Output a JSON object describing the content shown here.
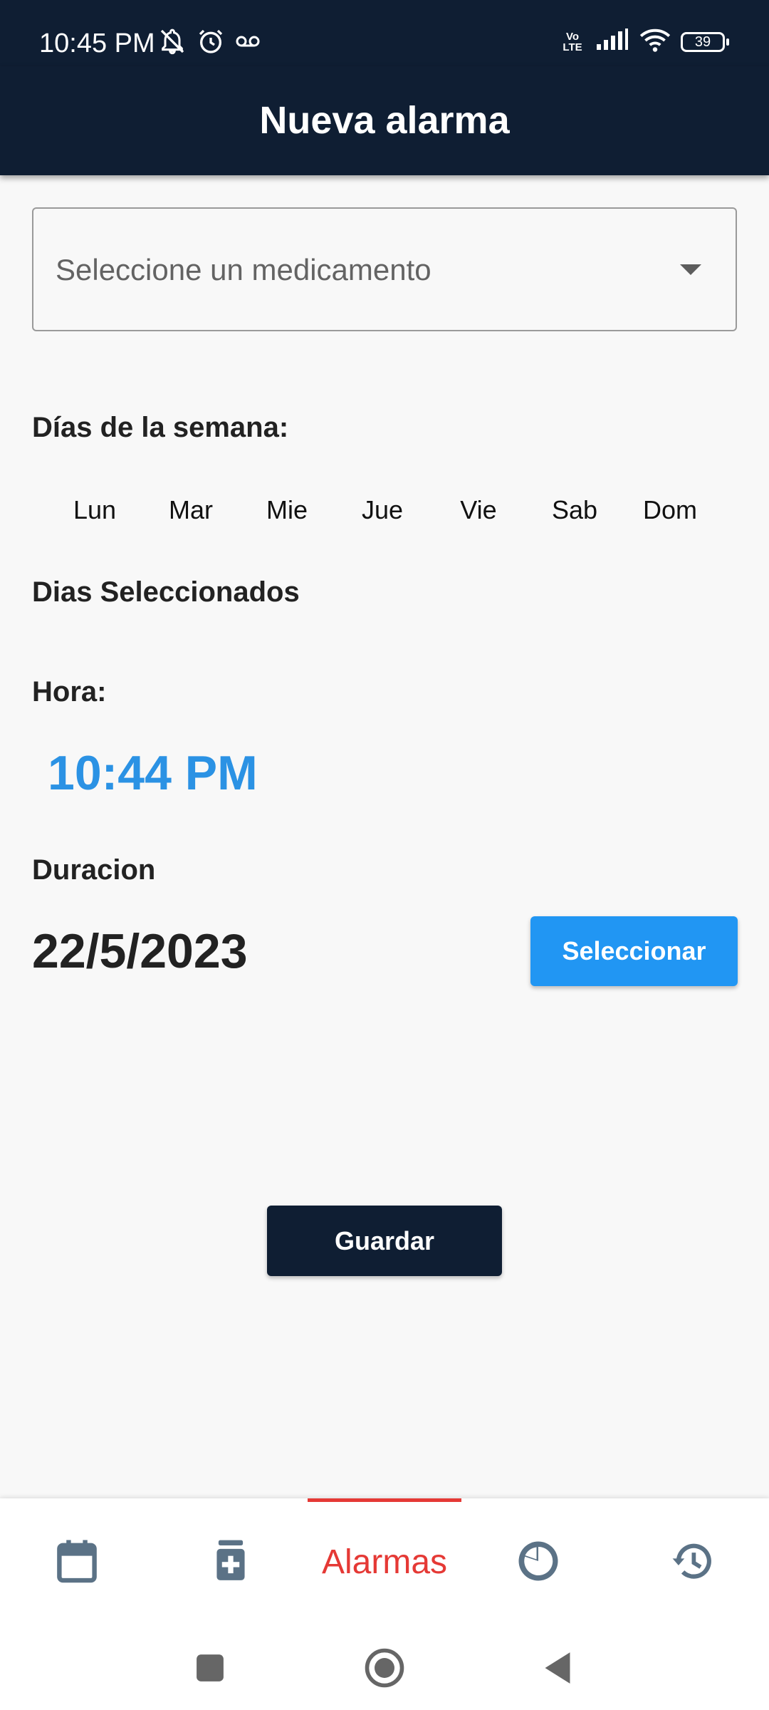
{
  "status_bar": {
    "time": "10:45 PM",
    "battery": "39",
    "network": "Vo LTE",
    "icons": [
      "bell-off-icon",
      "alarm-clock-icon",
      "voicemail-icon",
      "signal-icon",
      "wifi-icon",
      "battery-icon"
    ]
  },
  "app_bar": {
    "title": "Nueva alarma"
  },
  "form": {
    "medication_placeholder": "Seleccione un medicamento",
    "days_label": "Días de la semana:",
    "days": [
      "Lun",
      "Mar",
      "Mie",
      "Jue",
      "Vie",
      "Sab",
      "Dom"
    ],
    "selected_days_label": "Dias Seleccionados",
    "hour_label": "Hora:",
    "hour_value": "10:44 PM",
    "duration_label": "Duracion",
    "duration_value": "22/5/2023",
    "select_button": "Seleccionar",
    "save_button": "Guardar"
  },
  "bottom_nav": {
    "active_label": "Alarmas",
    "items": [
      {
        "icon": "calendar-icon"
      },
      {
        "icon": "medicine-icon"
      },
      {
        "icon": "alarm-icon",
        "label": "Alarmas",
        "active": true
      },
      {
        "icon": "pie-chart-icon"
      },
      {
        "icon": "history-icon"
      }
    ]
  },
  "colors": {
    "primary_dark": "#0f1e33",
    "accent_blue": "#2196f3",
    "time_blue": "#2b92e4",
    "active_red": "#e53935",
    "icon_slate": "#5b7286"
  }
}
